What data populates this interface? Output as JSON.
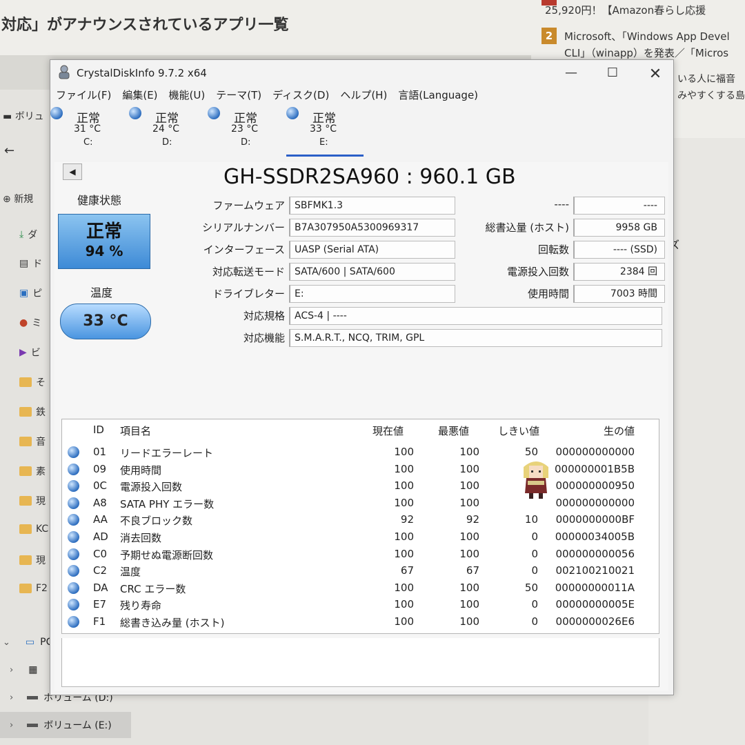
{
  "background": {
    "headline": "対応」がアナウンスされているアプリ一覧",
    "news": [
      {
        "text": "25,920円！【Amazon春らし応援"
      },
      {
        "num": "2",
        "text": "Microsoft、「Windows App Devel"
      },
      {
        "text": "CLI」（winapp）を発表／「Micros"
      }
    ],
    "side_snippets": [
      "いる人に福音",
      "みやすくする島"
    ],
    "explorer": {
      "volume_label": "ボリュ",
      "new_label": "新規",
      "items": [
        "ダ",
        "ド",
        "ピ",
        "ミ",
        "ビ",
        "そ",
        "鉄",
        "音",
        "素",
        "現",
        "KC",
        "現",
        "F2"
      ],
      "pc_label": "PC",
      "drive_d": "ボリューム (D:)",
      "drive_e": "ボリューム (E:)",
      "right_fragment": "ズ"
    }
  },
  "window": {
    "title": "CrystalDiskInfo 9.7.2 x64",
    "menu": [
      "ファイル(F)",
      "編集(E)",
      "機能(U)",
      "テーマ(T)",
      "ディスク(D)",
      "ヘルプ(H)",
      "言語(Language)"
    ],
    "disks": [
      {
        "status": "正常",
        "temp": "31 °C",
        "drive": "C:"
      },
      {
        "status": "正常",
        "temp": "24 °C",
        "drive": "D:"
      },
      {
        "status": "正常",
        "temp": "23 °C",
        "drive": "D:"
      },
      {
        "status": "正常",
        "temp": "33 °C",
        "drive": "E:"
      }
    ],
    "model": "GH-SSDR2SA960 : 960.1 GB",
    "health_label": "健康状態",
    "health_status": "正常",
    "health_percent": "94 %",
    "temp_label": "温度",
    "temp_value": "33 °C",
    "info_left": [
      {
        "label": "ファームウェア",
        "value": "SBFMK1.3"
      },
      {
        "label": "シリアルナンバー",
        "value": "B7A307950A5300969317"
      },
      {
        "label": "インターフェース",
        "value": "UASP (Serial ATA)"
      },
      {
        "label": "対応転送モード",
        "value": "SATA/600 | SATA/600"
      },
      {
        "label": "ドライブレター",
        "value": "E:"
      }
    ],
    "info_wide": [
      {
        "label": "対応規格",
        "value": "ACS-4 | ----"
      },
      {
        "label": "対応機能",
        "value": "S.M.A.R.T., NCQ, TRIM, GPL"
      }
    ],
    "info_right": [
      {
        "label": "----",
        "value": "----"
      },
      {
        "label": "総書込量 (ホスト)",
        "value": "9958 GB"
      },
      {
        "label": "回転数",
        "value": "---- (SSD)"
      },
      {
        "label": "電源投入回数",
        "value": "2384 回"
      },
      {
        "label": "使用時間",
        "value": "7003 時間"
      }
    ],
    "smart_headers": {
      "id": "ID",
      "name": "項目名",
      "current": "現在値",
      "worst": "最悪値",
      "threshold": "しきい値",
      "raw": "生の値"
    },
    "smart": [
      {
        "id": "01",
        "name": "リードエラーレート",
        "current": "100",
        "worst": "100",
        "threshold": "50",
        "raw": "000000000000"
      },
      {
        "id": "09",
        "name": "使用時間",
        "current": "100",
        "worst": "100",
        "threshold": "",
        "raw": "000000001B5B"
      },
      {
        "id": "0C",
        "name": "電源投入回数",
        "current": "100",
        "worst": "100",
        "threshold": "",
        "raw": "000000000950"
      },
      {
        "id": "A8",
        "name": "SATA PHY エラー数",
        "current": "100",
        "worst": "100",
        "threshold": "",
        "raw": "000000000000"
      },
      {
        "id": "AA",
        "name": "不良ブロック数",
        "current": "92",
        "worst": "92",
        "threshold": "10",
        "raw": "0000000000BF"
      },
      {
        "id": "AD",
        "name": "消去回数",
        "current": "100",
        "worst": "100",
        "threshold": "0",
        "raw": "00000034005B"
      },
      {
        "id": "C0",
        "name": "予期せぬ電源断回数",
        "current": "100",
        "worst": "100",
        "threshold": "0",
        "raw": "000000000056"
      },
      {
        "id": "C2",
        "name": "温度",
        "current": "67",
        "worst": "67",
        "threshold": "0",
        "raw": "002100210021"
      },
      {
        "id": "DA",
        "name": "CRC エラー数",
        "current": "100",
        "worst": "100",
        "threshold": "50",
        "raw": "00000000011A"
      },
      {
        "id": "E7",
        "name": "残り寿命",
        "current": "100",
        "worst": "100",
        "threshold": "0",
        "raw": "00000000005E"
      },
      {
        "id": "F1",
        "name": "総書き込み量 (ホスト)",
        "current": "100",
        "worst": "100",
        "threshold": "0",
        "raw": "0000000026E6"
      }
    ]
  }
}
